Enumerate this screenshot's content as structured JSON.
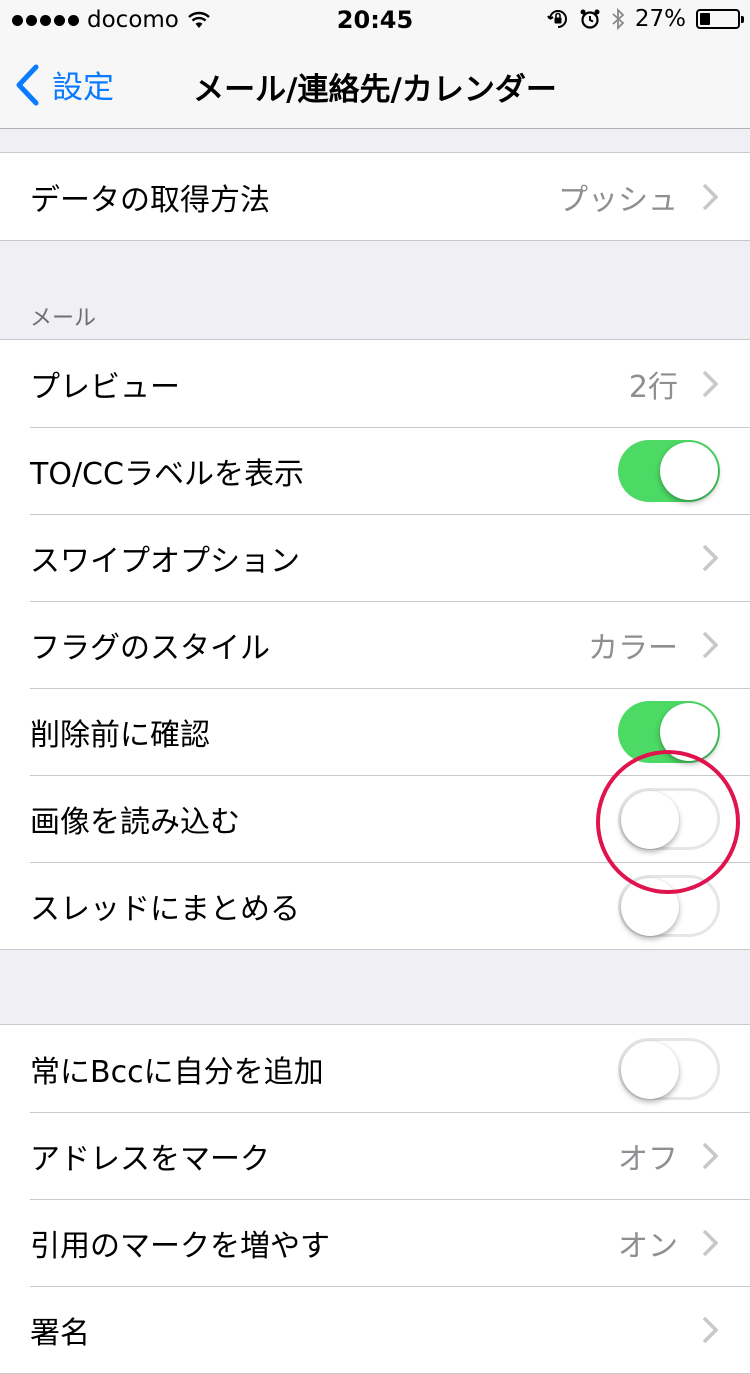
{
  "status_bar": {
    "carrier": "docomo",
    "time": "20:45",
    "battery_percent": "27%",
    "battery_level": 0.27,
    "icons": [
      "signal-dots-icon",
      "wifi-icon",
      "orientation-lock-icon",
      "alarm-icon",
      "bluetooth-icon",
      "battery-icon"
    ]
  },
  "nav": {
    "back_label": "設定",
    "title": "メール/連絡先/カレンダー"
  },
  "group_fetch": {
    "rows": [
      {
        "label": "データの取得方法",
        "detail": "プッシュ"
      }
    ]
  },
  "mail_section": {
    "header": "メール",
    "rows": [
      {
        "label": "プレビュー",
        "detail": "2行"
      },
      {
        "label": "TO/CCラベルを表示",
        "toggle": true
      },
      {
        "label": "スワイプオプション",
        "detail": ""
      },
      {
        "label": "フラグのスタイル",
        "detail": "カラー"
      },
      {
        "label": "削除前に確認",
        "toggle": true
      },
      {
        "label": "画像を読み込む",
        "toggle": false
      },
      {
        "label": "スレッドにまとめる",
        "toggle": false
      }
    ]
  },
  "compose_section": {
    "rows": [
      {
        "label": "常にBccに自分を追加",
        "toggle": false
      },
      {
        "label": "アドレスをマーク",
        "detail": "オフ"
      },
      {
        "label": "引用のマークを増やす",
        "detail": "オン"
      },
      {
        "label": "署名",
        "detail": ""
      }
    ]
  },
  "colors": {
    "accent": "#0a7aff",
    "toggle_on": "#4cd964",
    "highlight_circle": "#e0134f",
    "background": "#efeff4"
  }
}
